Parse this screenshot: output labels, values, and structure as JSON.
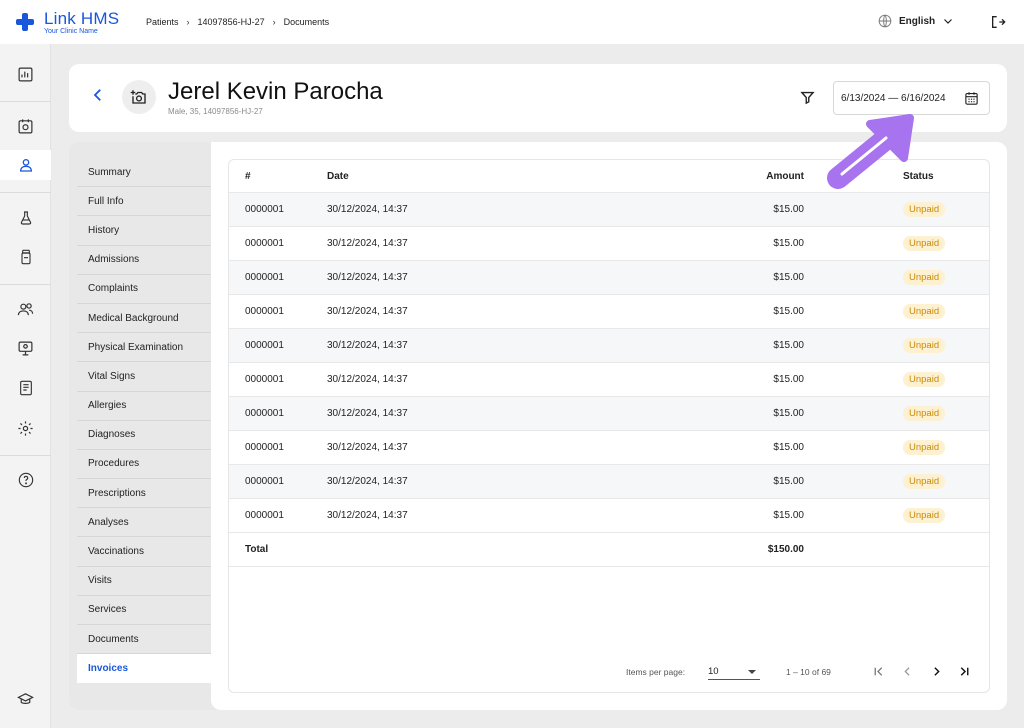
{
  "app": {
    "name": "Link HMS",
    "clinic": "Your Clinic Name",
    "brand_color": "#1a56db"
  },
  "breadcrumb": [
    "Patients",
    "14097856-HJ-27",
    "Documents"
  ],
  "language": {
    "label": "English"
  },
  "rail": {
    "icons": [
      "dashboard-icon",
      "calendar-icon",
      "patient-icon",
      "lab-flask-icon",
      "medicine-bottle-icon",
      "staff-icon",
      "monitor-icon",
      "report-icon",
      "settings-icon",
      "help-icon",
      "graduation-cap-icon"
    ],
    "active": "patient-icon"
  },
  "patient": {
    "name": "Jerel Kevin Parocha",
    "meta": "Male, 35, 14097856-HJ-27"
  },
  "date_range": {
    "value": "6/13/2024 — 6/16/2024"
  },
  "subnav": {
    "items": [
      "Summary",
      "Full Info",
      "History",
      "Admissions",
      "Complaints",
      "Medical Background",
      "Physical Examination",
      "Vital Signs",
      "Allergies",
      "Diagnoses",
      "Procedures",
      "Prescriptions",
      "Analyses",
      "Vaccinations",
      "Visits",
      "Services",
      "Documents",
      "Invoices"
    ],
    "active": "Invoices"
  },
  "table": {
    "headers": {
      "num": "#",
      "date": "Date",
      "amount": "Amount",
      "status": "Status"
    },
    "rows": [
      {
        "num": "0000001",
        "date": "30/12/2024, 14:37",
        "amount": "$15.00",
        "status": "Unpaid"
      },
      {
        "num": "0000001",
        "date": "30/12/2024, 14:37",
        "amount": "$15.00",
        "status": "Unpaid"
      },
      {
        "num": "0000001",
        "date": "30/12/2024, 14:37",
        "amount": "$15.00",
        "status": "Unpaid"
      },
      {
        "num": "0000001",
        "date": "30/12/2024, 14:37",
        "amount": "$15.00",
        "status": "Unpaid"
      },
      {
        "num": "0000001",
        "date": "30/12/2024, 14:37",
        "amount": "$15.00",
        "status": "Unpaid"
      },
      {
        "num": "0000001",
        "date": "30/12/2024, 14:37",
        "amount": "$15.00",
        "status": "Unpaid"
      },
      {
        "num": "0000001",
        "date": "30/12/2024, 14:37",
        "amount": "$15.00",
        "status": "Unpaid"
      },
      {
        "num": "0000001",
        "date": "30/12/2024, 14:37",
        "amount": "$15.00",
        "status": "Unpaid"
      },
      {
        "num": "0000001",
        "date": "30/12/2024, 14:37",
        "amount": "$15.00",
        "status": "Unpaid"
      },
      {
        "num": "0000001",
        "date": "30/12/2024, 14:37",
        "amount": "$15.00",
        "status": "Unpaid"
      }
    ],
    "total": {
      "label": "Total",
      "amount": "$150.00"
    }
  },
  "pager": {
    "items_per_page_label": "Items per page:",
    "items_per_page": "10",
    "range": "1 – 10 of 69"
  },
  "colors": {
    "badge_bg": "#fdf1d2",
    "badge_text": "#c98a06",
    "annotation": "#a873ee"
  }
}
